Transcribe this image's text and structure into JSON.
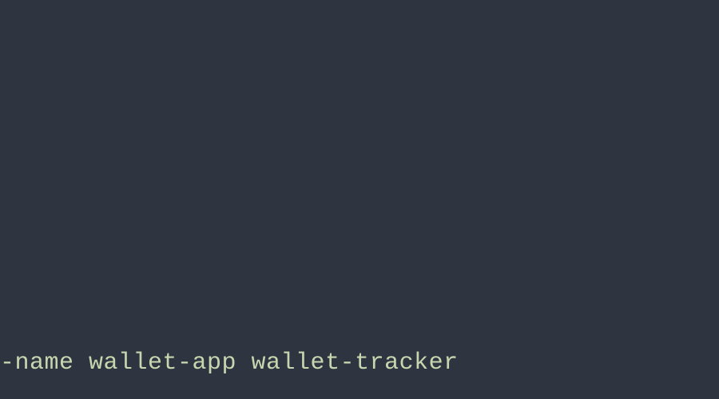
{
  "terminal": {
    "command_fragment": "-name wallet-app wallet-tracker"
  }
}
